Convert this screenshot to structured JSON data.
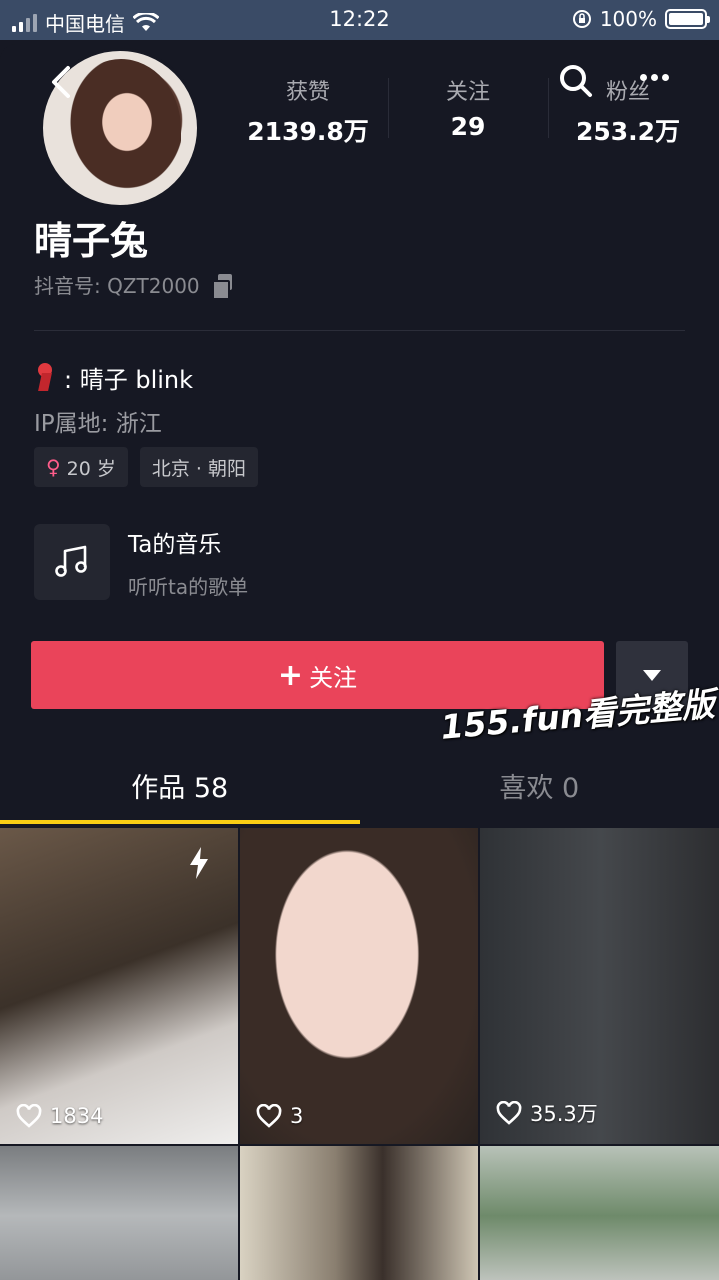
{
  "status_bar": {
    "carrier": "中国电信",
    "time": "12:22",
    "battery_text": "100%",
    "battery_level": 1.0
  },
  "profile": {
    "name": "晴子兔",
    "douyin_id": "抖音号: QZT2000",
    "stats": [
      {
        "label": "获赞",
        "value": "2139.8万"
      },
      {
        "label": "关注",
        "value": "29"
      },
      {
        "label": "粉丝",
        "value": "253.2万"
      }
    ],
    "bio": ": 晴子 blink",
    "ip_location": "IP属地: 浙江",
    "tags": [
      "20 岁",
      "北京 · 朝阳"
    ]
  },
  "music": {
    "title": "Ta的音乐",
    "subtitle": "听听ta的歌单"
  },
  "actions": {
    "follow_label": "关注"
  },
  "watermark": "155.fun看完整版",
  "tabs": [
    {
      "label": "作品 58",
      "active": true
    },
    {
      "label": "喜欢 0",
      "active": false
    }
  ],
  "videos": [
    {
      "likes": "1834"
    },
    {
      "likes": "3"
    },
    {
      "likes": "35.3万"
    }
  ],
  "colors": {
    "background": "#161823",
    "follow_button": "#ea445a",
    "tab_indicator": "#face15"
  }
}
